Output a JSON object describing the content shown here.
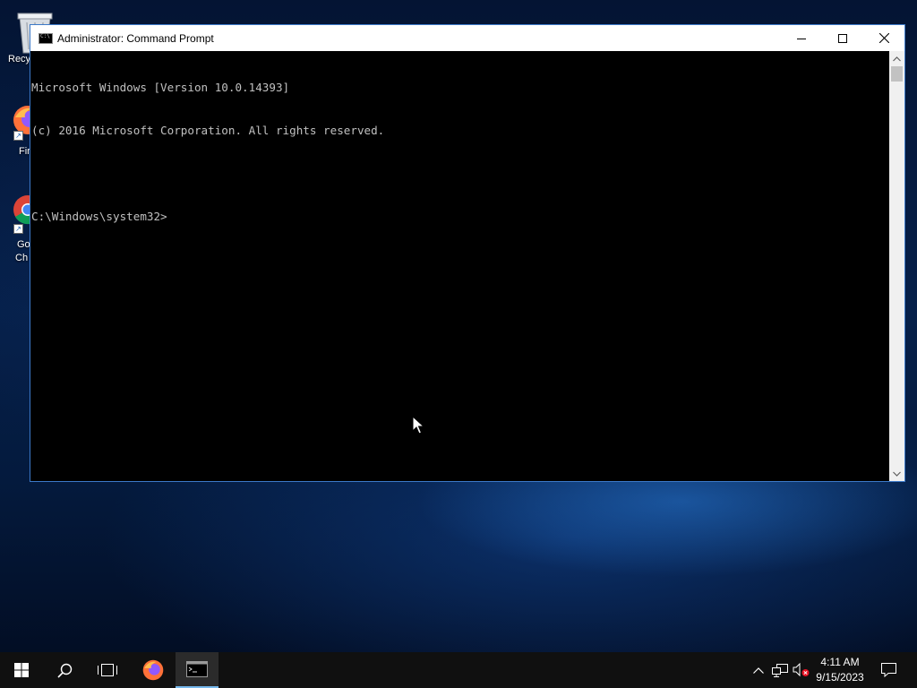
{
  "desktop": {
    "icons": [
      {
        "label": "Recy",
        "icon": "recycle-bin-icon"
      },
      {
        "label": "Fir",
        "icon": "firefox-icon"
      },
      {
        "label_line1": "Go",
        "label_line2": "Ch",
        "icon": "chrome-icon"
      }
    ]
  },
  "window": {
    "title": "Administrator: Command Prompt",
    "icon": "cmd-icon",
    "controls": [
      "minimize-icon",
      "maximize-icon",
      "close-icon"
    ]
  },
  "console": {
    "line1": "Microsoft Windows [Version 10.0.14393]",
    "line2": "(c) 2016 Microsoft Corporation. All rights reserved.",
    "prompt": "C:\\Windows\\system32>"
  },
  "taskbar": {
    "buttons": [
      "windows-start-icon",
      "search-icon",
      "task-view-icon",
      "firefox-icon",
      "cmd-icon"
    ],
    "tray": [
      "chevron-up-icon",
      "network-icon",
      "volume-muted-icon"
    ],
    "time": "4:11 AM",
    "date": "9/15/2023",
    "action_center": "notification-icon"
  },
  "colors": {
    "console_bg": "#000000",
    "console_text": "#c0c0c0",
    "taskbar_bg": "#101010",
    "window_border": "#3c79c8",
    "active_indicator": "#76b9ed"
  }
}
